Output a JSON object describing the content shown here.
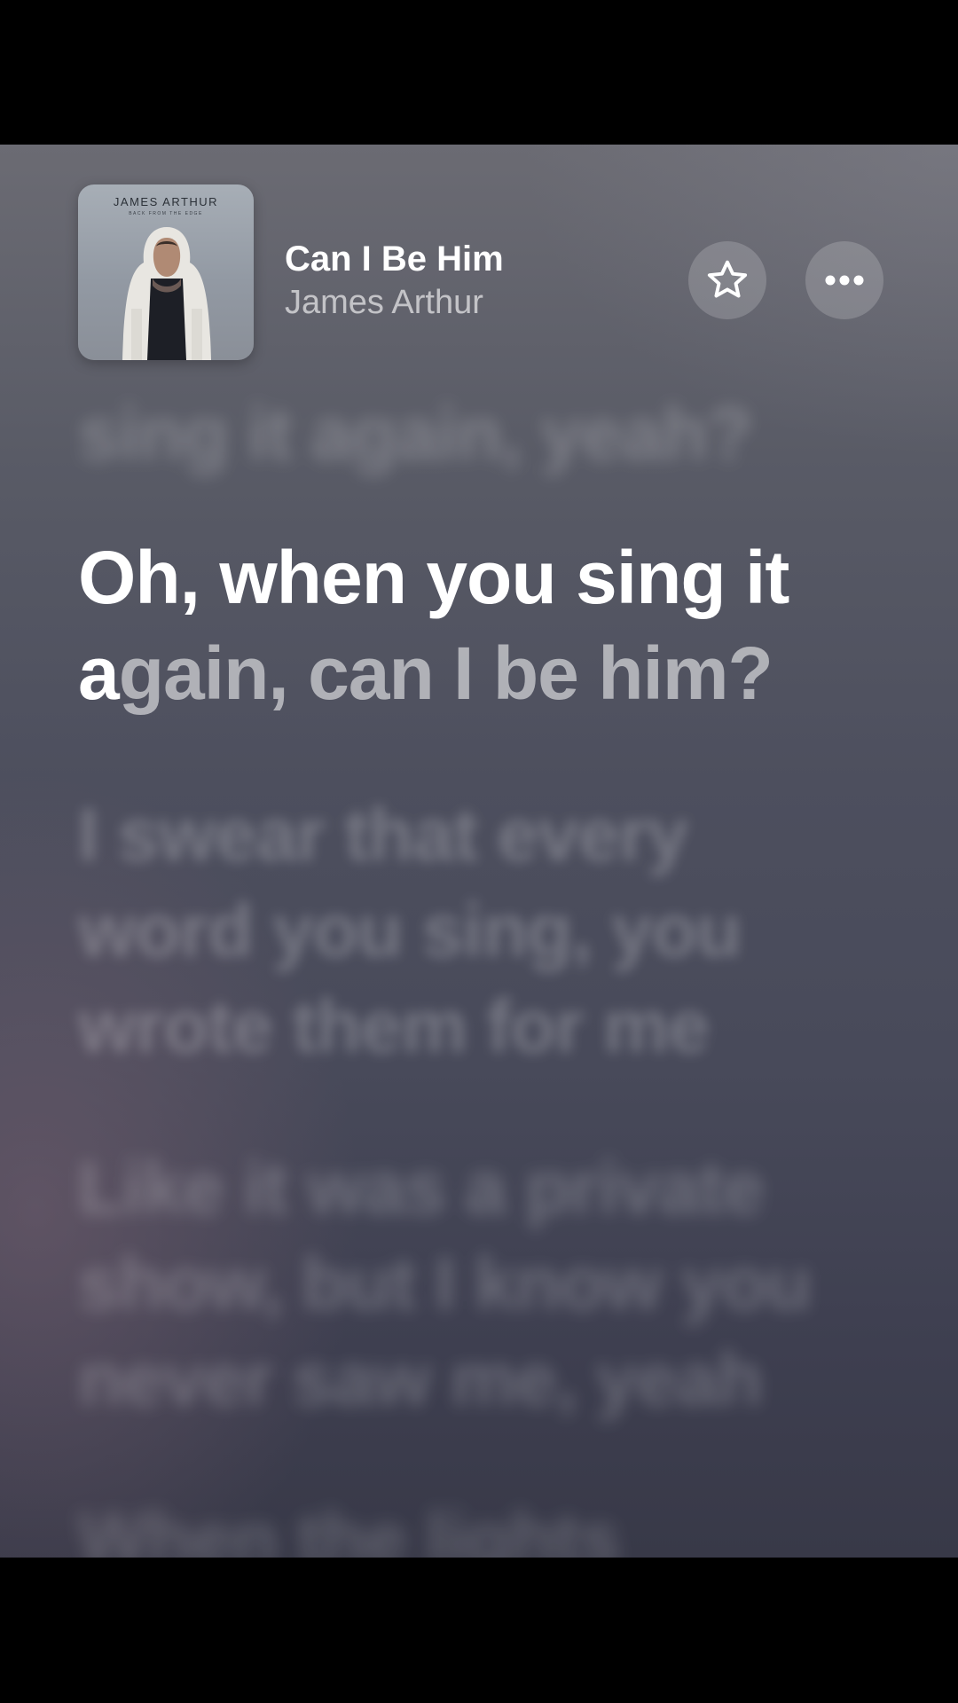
{
  "now_playing": {
    "title": "Can I Be Him",
    "artist": "James Arthur",
    "artwork": {
      "artist_text": "JAMES ARTHUR",
      "album_text": "BACK FROM THE EDGE"
    }
  },
  "actions": {
    "favorite_icon": "star-outline-icon",
    "more_icon": "ellipsis-icon"
  },
  "lyrics": {
    "previous": "sing it again, yeah?",
    "current": {
      "line1": "Oh, when you sing it",
      "line2_sung": "a",
      "line2_unsung": "gain, can I be him?"
    },
    "next1": {
      "line1": "I swear that every",
      "line2": "word you sing, you",
      "line3": "wrote them for me"
    },
    "next2": {
      "line1": "Like it was a private",
      "line2": "show, but I know you",
      "line3": "never saw me, yeah"
    },
    "next3": {
      "line1": "When the lights"
    }
  },
  "colors": {
    "background_top": "#6b6b73",
    "background_bottom": "#383948",
    "active_lyric": "#ffffff"
  }
}
